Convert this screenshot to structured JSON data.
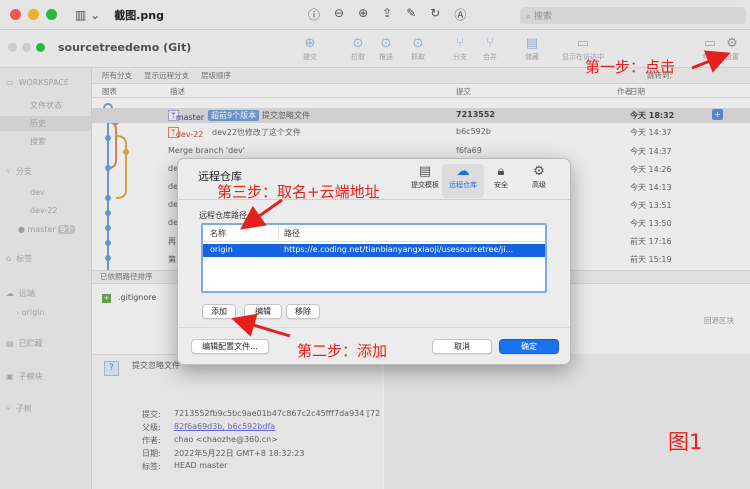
{
  "preview": {
    "title": "截图.png",
    "search_placeholder": "搜索"
  },
  "app": {
    "repo_title": "sourcetreedemo (Git)",
    "toolbar": [
      "提交",
      "拉取",
      "推送",
      "抓取",
      "分支",
      "合并",
      "储藏",
      "显示在访达中",
      "终端",
      "设置"
    ]
  },
  "sidebar": {
    "workspace": "WORKSPACE",
    "file_status": "文件状态",
    "history": "历史",
    "search": "搜索",
    "branches": "分支",
    "branch_items": [
      "dev",
      "dev-22",
      "master"
    ],
    "master_badge": "9个",
    "tags": "标签",
    "remotes": "远端",
    "remote_origin": "origin",
    "stashes": "已贮藏",
    "submodules": "子模块",
    "subtrees": "子树"
  },
  "filter": {
    "branches": "所有分支",
    "show_remote": "显示远程分支",
    "order": "层级顺序",
    "jump": "跳转到:"
  },
  "columns": {
    "graph": "图表",
    "description": "描述",
    "commit": "提交",
    "author": "作者",
    "date": "日期"
  },
  "commits": [
    {
      "branch": "master",
      "ahead": "超前9个版本",
      "desc": "提交忽略文件",
      "hash": "7213552",
      "date": "今天 18:32"
    },
    {
      "branch": "dev-22",
      "desc": "dev22也修改了这个文件",
      "hash": "b6c592b",
      "date": "今天 14:37"
    },
    {
      "desc": "Merge branch 'dev'",
      "hash": "f6fa69",
      "date": "今天 14:37"
    },
    {
      "desc": "de",
      "hash": "",
      "date": "今天 14:26"
    },
    {
      "desc": "de",
      "hash": "",
      "date": "今天 14:13"
    },
    {
      "desc": "de",
      "hash": "",
      "date": "今天 13:51"
    },
    {
      "desc": "de",
      "hash": "",
      "date": "今天 13:50"
    },
    {
      "desc": "再",
      "hash": "",
      "date": "前天 17:16"
    },
    {
      "desc": "第",
      "hash": "",
      "date": "前天 15:19"
    }
  ],
  "lower": {
    "sort": "已依照路径排序",
    "file": ".gitignore",
    "revert": "回退区块"
  },
  "detail": {
    "message": "提交忽略文件",
    "labels": [
      "提交:",
      "父级:",
      "作者:",
      "日期:",
      "标签:"
    ],
    "commit": "7213552fb9c5bc9ae01b47c867c2c45fff7da934 [72",
    "parents": "82f6a69d3b, b6c592bdfa",
    "author": "chao <chaozhe@360.cn>",
    "date": "2022年5月22日 GMT+8 18:32:23",
    "labels_value": "HEAD master"
  },
  "dialog": {
    "title": "远程仓库",
    "tabs": [
      "提交模板",
      "远程仓库",
      "安全",
      "高级"
    ],
    "path_label": "远程仓库路径:",
    "col_name": "名称",
    "col_path": "路径",
    "remote_name": "origin",
    "remote_url": "https://e.coding.net/tianbianyangxiaoji/usesourcetree/ji...",
    "add": "添加",
    "edit": "编辑",
    "remove": "移除",
    "edit_config": "编辑配置文件...",
    "cancel": "取消",
    "ok": "确定"
  },
  "annotations": {
    "step1": "第一步：点击",
    "step2": "第二步：添加",
    "step3": "第三步：取名+云端地址",
    "figure": "图1"
  },
  "colors": {
    "annotation": "#e6201c",
    "selection": "#1563e0",
    "primary_button": "#1a72ee"
  }
}
